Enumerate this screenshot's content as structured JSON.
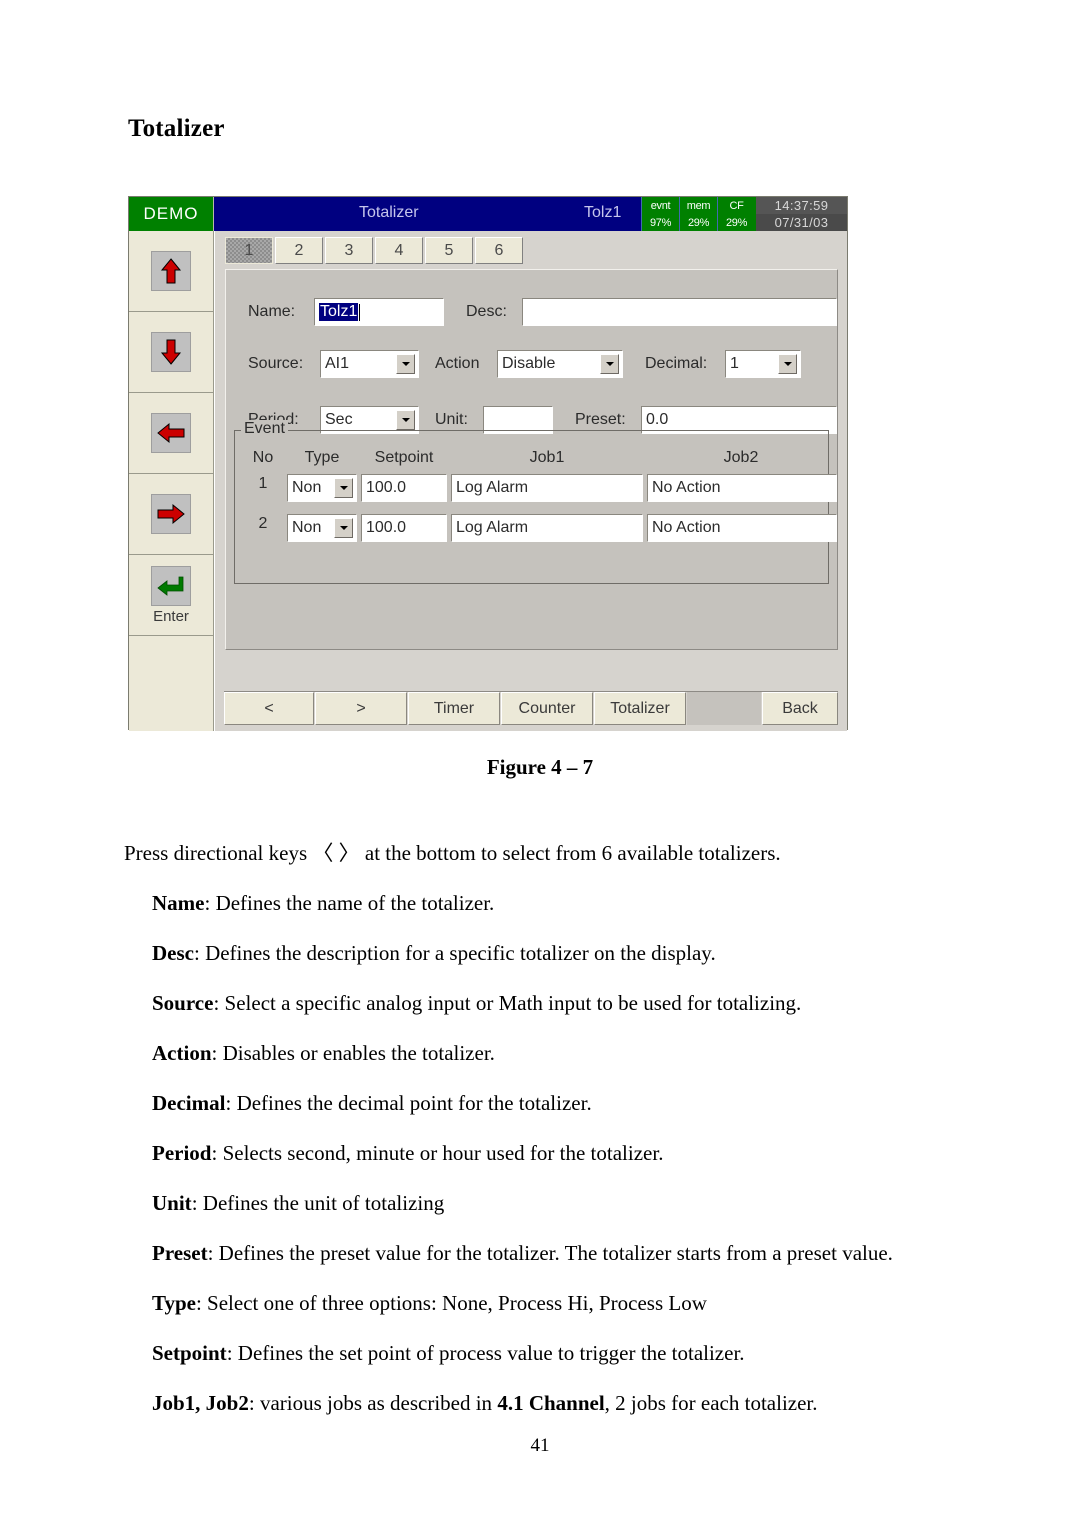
{
  "document": {
    "heading": "Totalizer",
    "figure_caption": "Figure 4 –  7",
    "page_number": "41",
    "paragraphs": [
      {
        "lead": "",
        "text": "Press directional keys 〈 〉 at the bottom to select from 6 available totalizers.",
        "indent": false
      },
      {
        "lead": "Name",
        "text": ": Defines the name of the totalizer.",
        "indent": true
      },
      {
        "lead": "Desc",
        "text": ":   Defines the description for a specific totalizer on the display.",
        "indent": true
      },
      {
        "lead": "Source",
        "text": ": Select a specific analog input or Math input to be used for totalizing.",
        "indent": true
      },
      {
        "lead": "Action",
        "text": ":  Disables or enables the totalizer.",
        "indent": true
      },
      {
        "lead": "Decimal",
        "text": ":  Defines the decimal point for the totalizer.",
        "indent": true
      },
      {
        "lead": "Period",
        "text": ":  Selects second, minute or hour used for the totalizer.",
        "indent": true
      },
      {
        "lead": "Unit",
        "text": ":  Defines the unit of totalizing",
        "indent": true
      },
      {
        "lead": "Preset",
        "text": ":  Defines the preset value for the totalizer.  The totalizer starts from a preset value.",
        "indent": true
      },
      {
        "lead": "Type",
        "text": ":  Select one of three options: None, Process Hi, Process Low",
        "indent": true
      },
      {
        "lead": "Setpoint",
        "text": ":  Defines the set point of process value to trigger the totalizer.",
        "indent": true
      },
      {
        "lead": "Job1, Job2",
        "text": ":  various jobs as described in ",
        "bold_mid": "4.1 Channel",
        "tail": ", 2 jobs for each totalizer.",
        "indent": true
      }
    ]
  },
  "device": {
    "titlebar": {
      "demo_badge": "DEMO",
      "screen_title": "Totalizer",
      "item_title": "Tolz1",
      "status": [
        {
          "name": "evnt",
          "value": "97%"
        },
        {
          "name": "mem",
          "value": "29%"
        },
        {
          "name": "CF",
          "value": "29%"
        }
      ],
      "time": "14:37:59",
      "date": "07/31/03"
    },
    "keypad": [
      {
        "name": "up-arrow",
        "label": ""
      },
      {
        "name": "down-arrow",
        "label": ""
      },
      {
        "name": "left-arrow",
        "label": ""
      },
      {
        "name": "right-arrow",
        "label": ""
      },
      {
        "name": "enter-arrow",
        "label": "Enter"
      }
    ],
    "tabs": [
      {
        "label": "1",
        "selected": true
      },
      {
        "label": "2",
        "selected": false
      },
      {
        "label": "3",
        "selected": false
      },
      {
        "label": "4",
        "selected": false
      },
      {
        "label": "5",
        "selected": false
      },
      {
        "label": "6",
        "selected": false
      }
    ],
    "form": {
      "name_label": "Name:",
      "name_value": "Tolz1",
      "desc_label": "Desc:",
      "desc_value": "",
      "source_label": "Source:",
      "source_value": "AI1",
      "action_label": "Action",
      "action_value": "Disable",
      "decimal_label": "Decimal:",
      "decimal_value": "1",
      "period_label": "Period:",
      "period_value": "Sec",
      "unit_label": "Unit:",
      "unit_value": "",
      "preset_label": "Preset:",
      "preset_value": "0.0"
    },
    "event": {
      "group_title": "Event",
      "headers": [
        "No",
        "Type",
        "Setpoint",
        "Job1",
        "Job2"
      ],
      "rows": [
        {
          "no": "1",
          "type": "Non",
          "setpoint": "100.0",
          "job1": "Log Alarm",
          "job2": "No Action"
        },
        {
          "no": "2",
          "type": "Non",
          "setpoint": "100.0",
          "job1": "Log Alarm",
          "job2": "No Action"
        }
      ]
    },
    "buttons": [
      {
        "label": "<",
        "blank": false
      },
      {
        "label": ">",
        "blank": false
      },
      {
        "label": "Timer",
        "blank": false
      },
      {
        "label": "Counter",
        "blank": false
      },
      {
        "label": "Totalizer",
        "blank": false
      },
      {
        "label": "",
        "blank": true
      },
      {
        "label": "Back",
        "blank": false
      }
    ]
  },
  "colors": {
    "titlebar_blue": "#000080",
    "badge_green": "#008000",
    "panel_gray": "#c5c2bd",
    "chrome_beige": "#ece9d8",
    "selection_blue": "#000080",
    "arrow_red": "#cc0000",
    "enter_green": "#007a00"
  }
}
